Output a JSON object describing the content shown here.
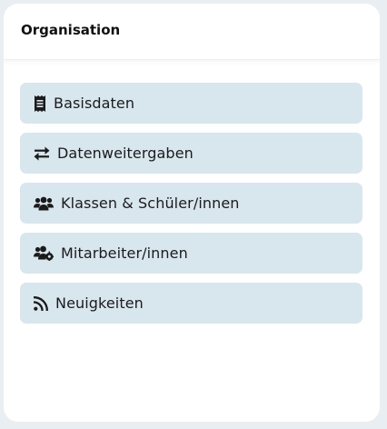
{
  "card": {
    "title": "Organisation"
  },
  "menu": {
    "items": [
      {
        "label": "Basisdaten",
        "icon": "receipt-icon"
      },
      {
        "label": "Datenweitergaben",
        "icon": "exchange-arrows-icon"
      },
      {
        "label": "Klassen & Schüler/innen",
        "icon": "users-icon"
      },
      {
        "label": "Mitarbeiter/innen",
        "icon": "users-cog-icon"
      },
      {
        "label": "Neuigkeiten",
        "icon": "rss-icon"
      }
    ]
  },
  "colors": {
    "page_background": "#e9eef2",
    "card_background": "#ffffff",
    "item_background": "#d8e6ee",
    "text": "#1b1b1b"
  }
}
